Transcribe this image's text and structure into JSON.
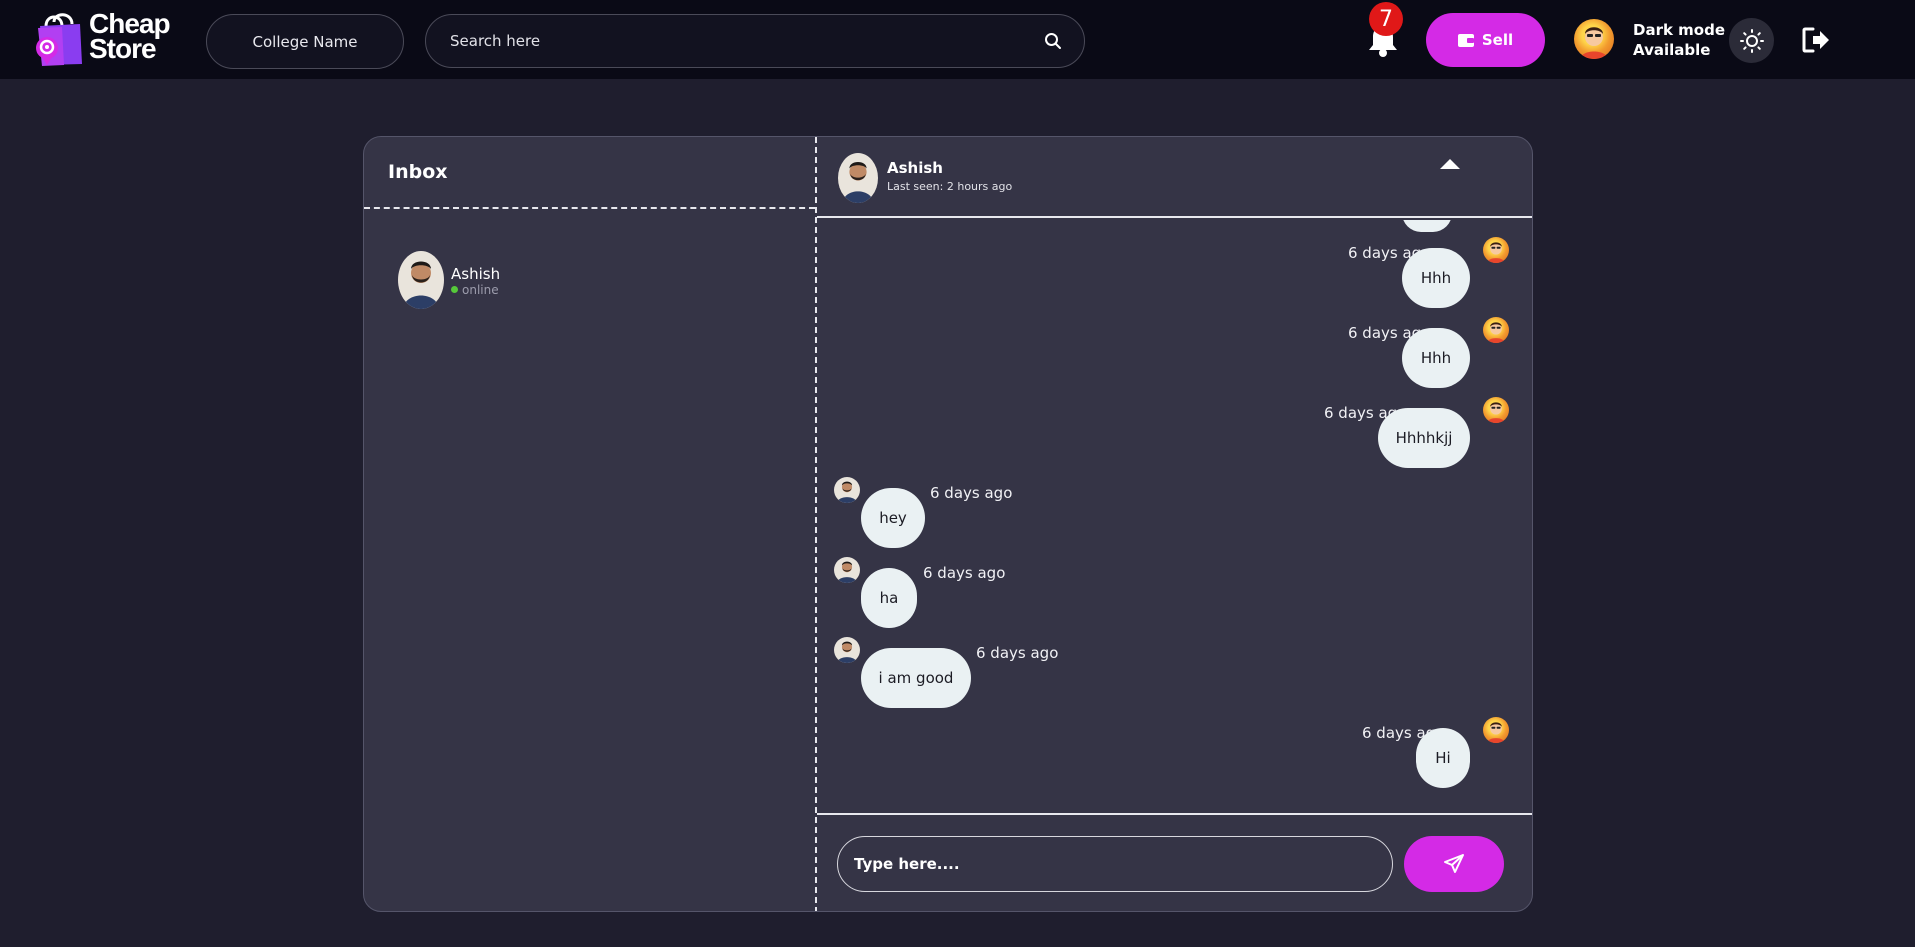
{
  "header": {
    "logo_line1": "Cheap",
    "logo_line2": "Store",
    "college_label": "College Name",
    "search_placeholder": "Search here",
    "notification_count": "7",
    "sell_label": "Sell",
    "dark_mode_line1": "Dark mode",
    "dark_mode_line2": "Available"
  },
  "inbox": {
    "title": "Inbox",
    "contacts": [
      {
        "name": "Ashish",
        "status": "online"
      }
    ]
  },
  "chat": {
    "contact_name": "Ashish",
    "last_seen": "Last seen: 2 hours ago",
    "messages": [
      {
        "text": "Hhh",
        "time": "6 days ago",
        "from": "me"
      },
      {
        "text": "Hhh",
        "time": "6 days ago",
        "from": "me"
      },
      {
        "text": "Hhhhkjj",
        "time": "6 days ago",
        "from": "me"
      },
      {
        "text": "hey",
        "time": "6 days ago",
        "from": "contact"
      },
      {
        "text": "ha",
        "time": "6 days ago",
        "from": "contact"
      },
      {
        "text": "i am good",
        "time": "6 days ago",
        "from": "contact"
      },
      {
        "text": "Hi",
        "time": "6 days ago",
        "from": "me"
      }
    ],
    "input_placeholder": "Type here...."
  },
  "colors": {
    "accent": "#d42ae6",
    "badge": "#e01818",
    "online": "#56c83a",
    "bubble": "#eaf1f3"
  },
  "icons": [
    "search-icon",
    "bell-icon",
    "wallet-icon",
    "sun-icon",
    "logout-icon",
    "send-icon"
  ]
}
